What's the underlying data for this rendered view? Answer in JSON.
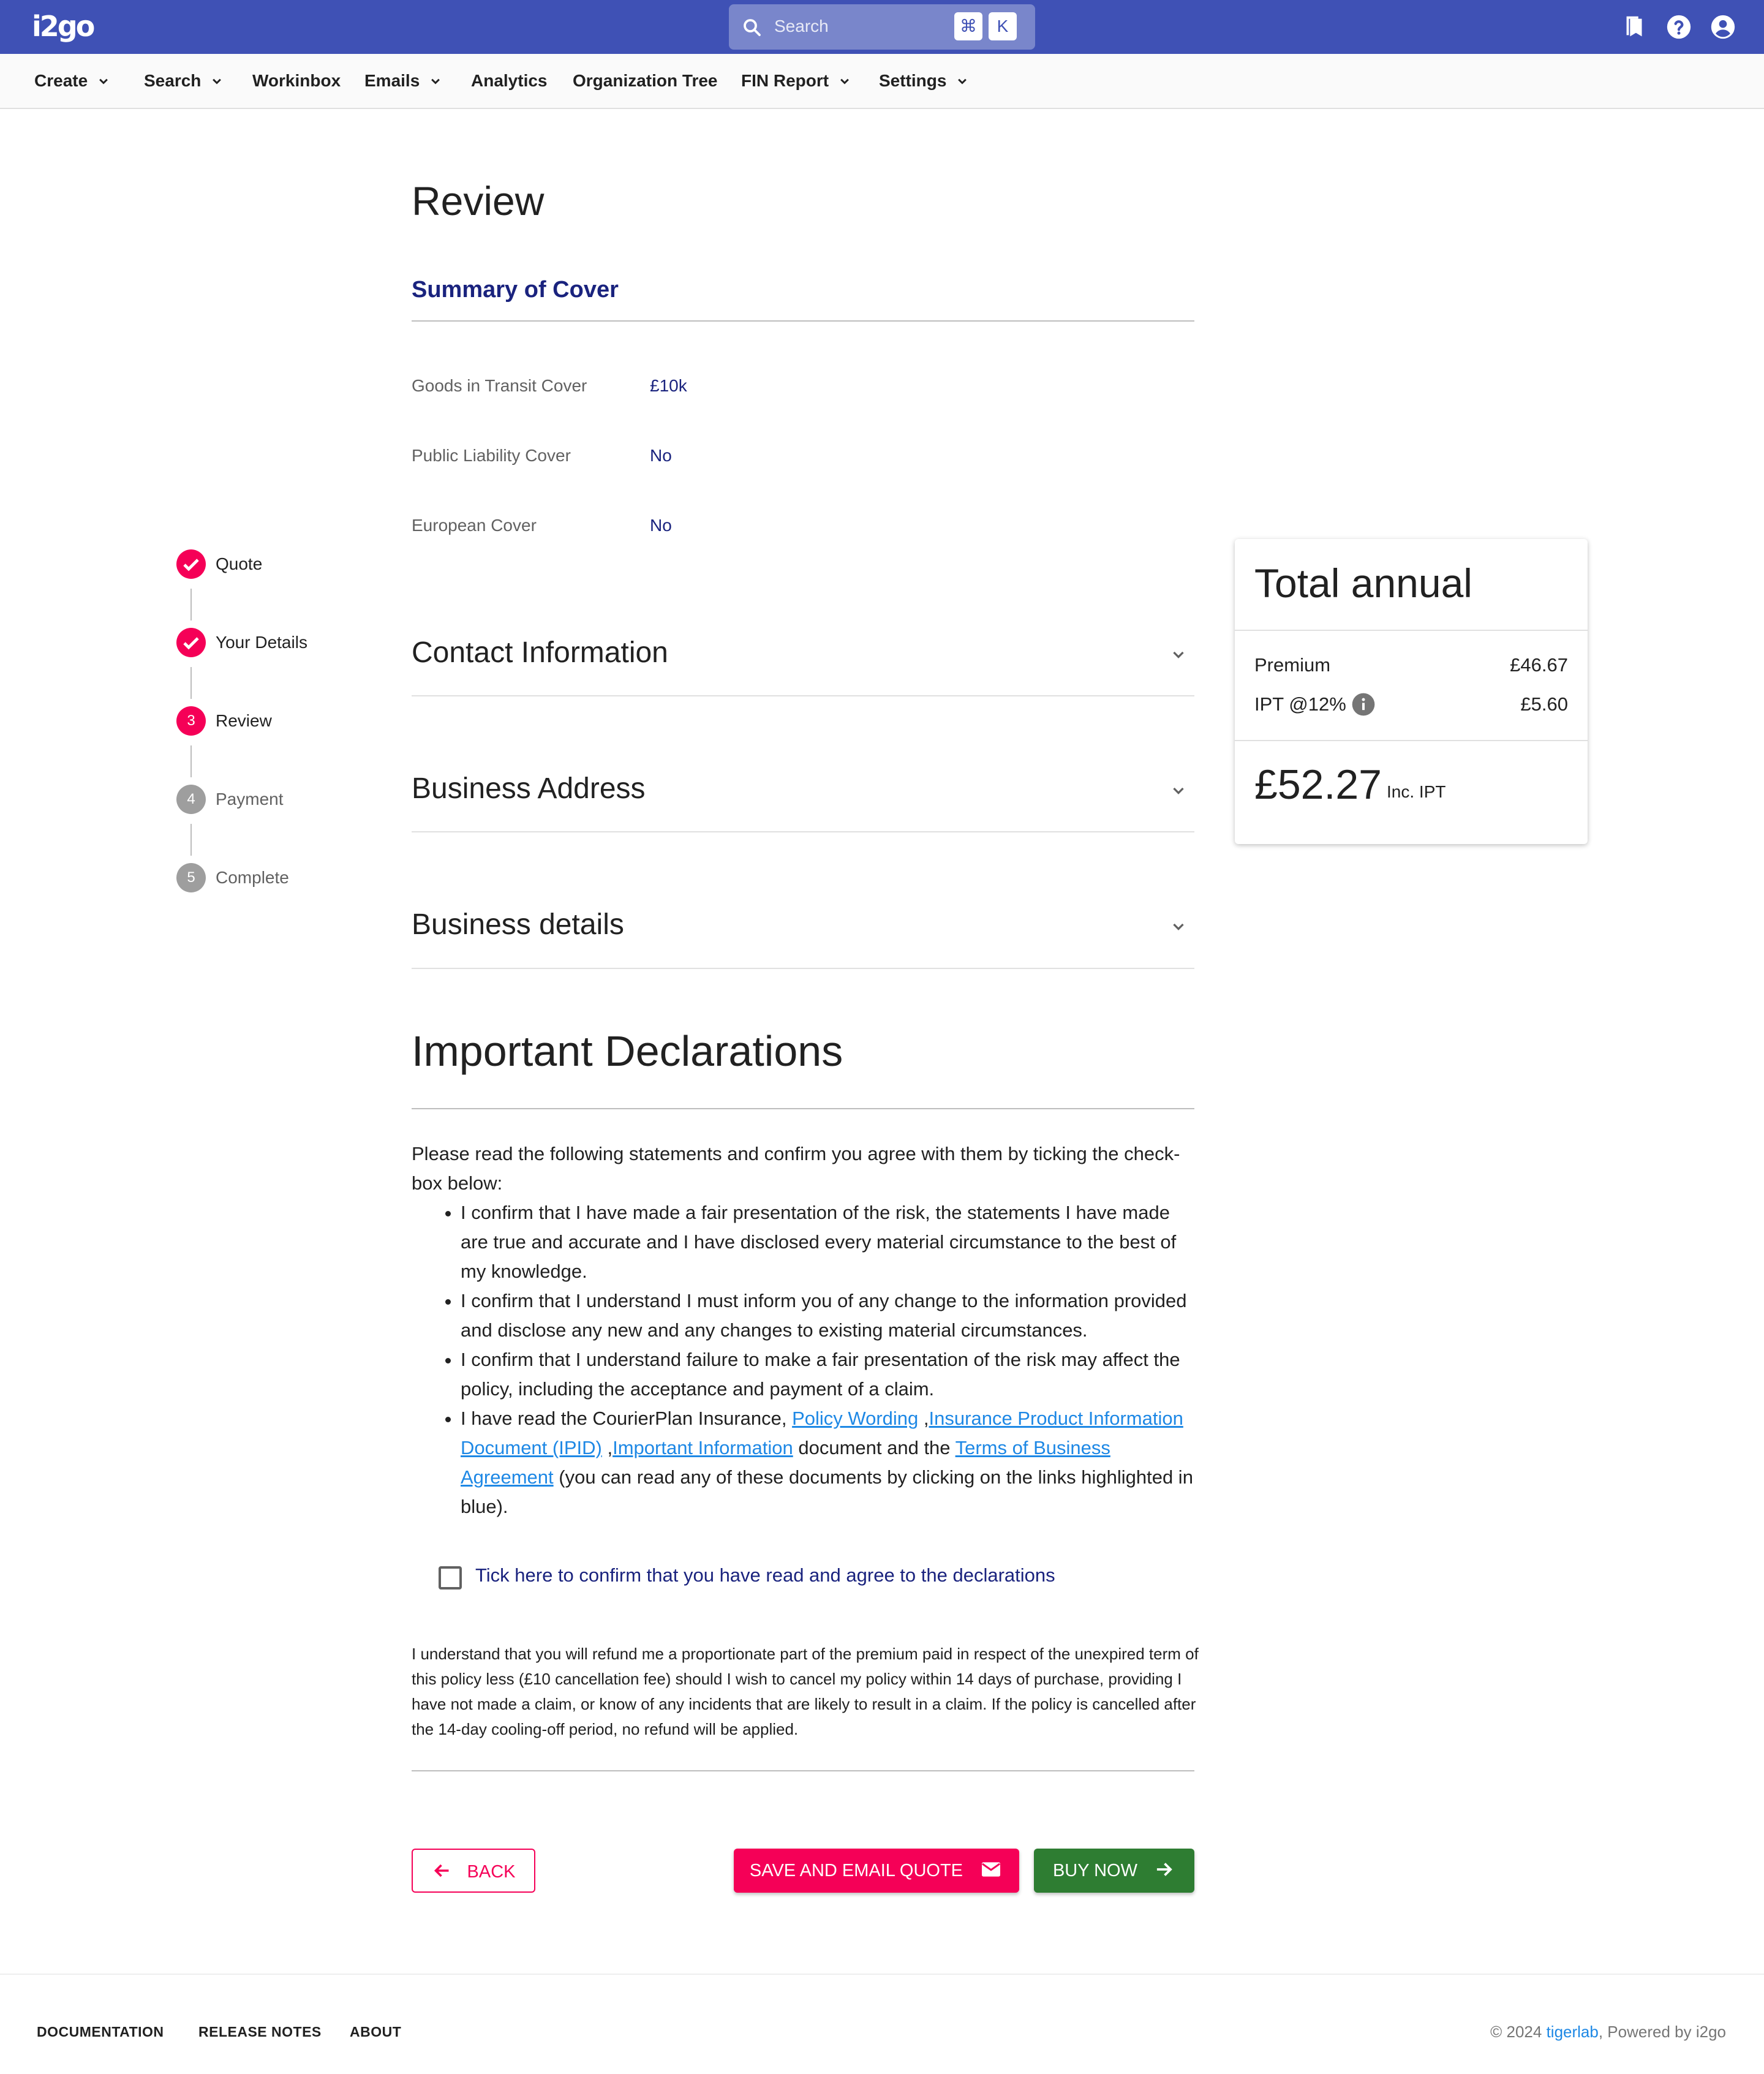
{
  "app": {
    "logo": "i2go",
    "search_placeholder": "Search",
    "shortcut_keys": [
      "⌘",
      "K"
    ]
  },
  "menu": {
    "items": [
      {
        "label": "Create",
        "dropdown": true
      },
      {
        "label": "Search",
        "dropdown": true
      },
      {
        "label": "Workinbox",
        "dropdown": false
      },
      {
        "label": "Emails",
        "dropdown": true
      },
      {
        "label": "Analytics",
        "dropdown": false
      },
      {
        "label": "Organization Tree",
        "dropdown": false
      },
      {
        "label": "FIN Report",
        "dropdown": true
      },
      {
        "label": "Settings",
        "dropdown": true
      }
    ]
  },
  "stepper": {
    "steps": [
      {
        "number": "1",
        "label": "Quote",
        "status": "done"
      },
      {
        "number": "2",
        "label": "Your Details",
        "status": "done"
      },
      {
        "number": "3",
        "label": "Review",
        "status": "active"
      },
      {
        "number": "4",
        "label": "Payment",
        "status": "pending"
      },
      {
        "number": "5",
        "label": "Complete",
        "status": "pending"
      }
    ]
  },
  "page": {
    "title": "Review",
    "summary_title": "Summary of Cover",
    "summary": [
      {
        "label": "Goods in Transit Cover",
        "value": "£10k"
      },
      {
        "label": "Public Liability Cover",
        "value": "No"
      },
      {
        "label": "European Cover",
        "value": "No"
      }
    ],
    "accordions": [
      {
        "title": "Contact Information"
      },
      {
        "title": "Business Address"
      },
      {
        "title": "Business details"
      }
    ]
  },
  "declarations": {
    "title": "Important Declarations",
    "intro": "Please read the following statements and confirm you agree with them by ticking the check-box below:",
    "bullet_1": "I confirm that I have made a fair presentation of the risk, the statements I have made are true and accurate and I have disclosed every material circumstance to the best of my knowledge.",
    "bullet_2": "I confirm that I understand I must inform you of any change to the information provided and disclose any new and any changes to existing material circumstances.",
    "bullet_3": "I confirm that I understand failure to make a fair presentation of the risk may affect the policy, including the acceptance and payment of a claim.",
    "bullet_4": {
      "prefix": "I have read the CourierPlan Insurance,",
      "link_policy_wording": "Policy Wording",
      "sep_1": ",",
      "link_ipid": "Insurance Product Information Document (IPID)",
      "sep_2": ",",
      "link_important_info": "Important Information",
      "middle": "document and the",
      "link_terms": "Terms of Business Agreement",
      "suffix": "(you can read any of these documents by clicking on the links highlighted in blue)."
    },
    "checkbox_label": "Tick here to confirm that you have read and agree to the declarations",
    "checkbox_checked": false,
    "refund_text": "I understand that you will refund me a proportionate part of the premium paid in respect of the unexpired term of this policy less (£10 cancellation fee) should I wish to cancel my policy within 14 days of purchase, providing I have not made a claim, or know of any incidents that are likely to result in a claim. If the policy is cancelled after the 14-day cooling-off period, no refund will be applied."
  },
  "buttons": {
    "back": "BACK",
    "save_email": "SAVE AND EMAIL QUOTE",
    "buy_now": "BUY NOW"
  },
  "total_card": {
    "title": "Total annual",
    "premium_label": "Premium",
    "premium_value": "£46.67",
    "ipt_label": "IPT @12%",
    "ipt_value": "£5.60",
    "total": "£52.27",
    "total_suffix": "Inc. IPT"
  },
  "footer": {
    "links": [
      "DOCUMENTATION",
      "RELEASE NOTES",
      "ABOUT"
    ],
    "copyright_prefix": "© 2024",
    "brand": "tigerlab",
    "powered": ", Powered by i2go"
  },
  "colors": {
    "topbar": "#3f51b5",
    "accent_pink": "#f50057",
    "buy_green": "#2e7d32",
    "link_blue": "#1e88e5",
    "heading_navy": "#1a237e"
  }
}
